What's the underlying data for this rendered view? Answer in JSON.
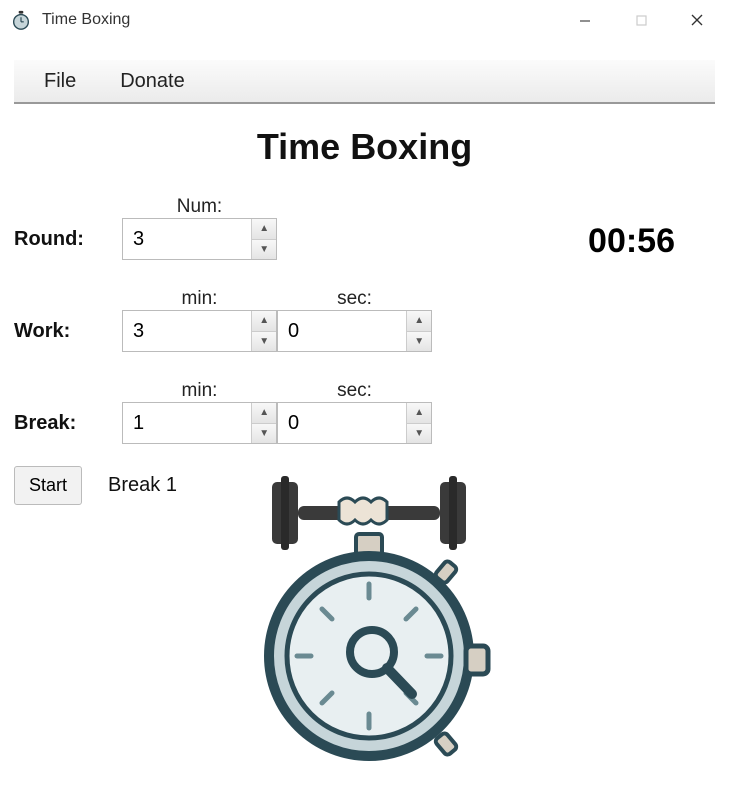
{
  "title": "Time Boxing",
  "menu": {
    "file": "File",
    "donate": "Donate"
  },
  "heading": "Time Boxing",
  "labels": {
    "num": "Num:",
    "min": "min:",
    "sec": "sec:",
    "round": "Round:",
    "work": "Work:",
    "break": "Break:"
  },
  "values": {
    "round_num": "3",
    "work_min": "3",
    "work_sec": "0",
    "break_min": "1",
    "break_sec": "0"
  },
  "timer": "00:56",
  "start_label": "Start",
  "status": "Break 1"
}
